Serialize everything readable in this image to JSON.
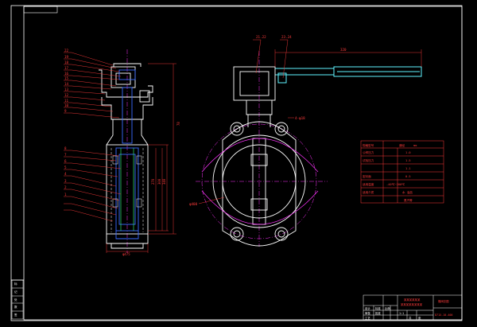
{
  "colors": {
    "background": "#000000",
    "frame": "#ffffff",
    "outline": "#ffffff",
    "callout": "#ff3b3b",
    "centerline": "#ff33ff",
    "dimension": "#ff3b3b",
    "handle": "#5ff5ff",
    "inner_blue": "#3a6bff",
    "table_text": "#ff3b3b",
    "title_text": "#ff3b3b"
  },
  "left_view": {
    "callout_labels": [
      "22",
      "19",
      "18",
      "17",
      "16",
      "15",
      "14",
      "13",
      "12",
      "11",
      "10",
      "9",
      "8",
      "7",
      "6",
      "5",
      "4",
      "3",
      "2",
      "1"
    ],
    "dim_height": "78",
    "dim_bore_1": "270",
    "dim_bore_2": "300",
    "dim_bore_3": "340",
    "dim_bottom": "φ475"
  },
  "right_view": {
    "callout_top_left": "21.22",
    "callout_top_right": "23.24",
    "dim_handle": "320",
    "note_flange": "4-φ18",
    "note_dia": "φ400"
  },
  "spec_table": {
    "header": [
      "规格型号",
      "通径",
      "mm"
    ],
    "rows": [
      [
        "公称压力",
        "",
        "1.0"
      ],
      [
        "试验压力",
        "",
        "1.5"
      ],
      [
        "",
        "",
        "1.1"
      ],
      [
        "密封面",
        "",
        "0.5"
      ],
      [
        "适用温度",
        "",
        "-40℃~200℃"
      ],
      [
        "适用介质",
        "",
        "水 油品"
      ],
      [
        "",
        "",
        "蒸汽等"
      ]
    ]
  },
  "title_block": {
    "company_line1": "某某某某某某",
    "company_line2": "某某某某某某某某",
    "drawing_name": "蝶阀总图",
    "drawing_number": "D71X-10-400",
    "small_cells": [
      "设计",
      "审核",
      "工艺",
      "标准",
      "批准",
      "比例",
      "1:1",
      "共",
      "张"
    ]
  },
  "revision_block": {
    "cells": [
      "标",
      "记",
      "处",
      "数",
      "签"
    ]
  }
}
